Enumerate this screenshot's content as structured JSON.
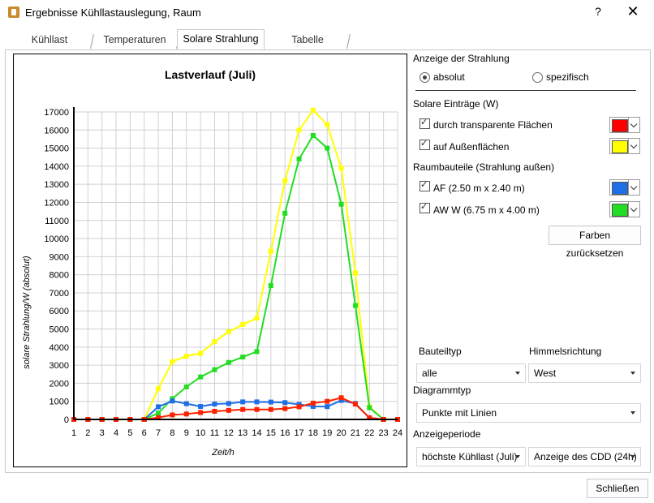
{
  "window": {
    "title": "Ergebnisse Kühllastauslegung, Raum",
    "help": "?",
    "close": "✕"
  },
  "tabs": [
    {
      "label": "Kühllast"
    },
    {
      "label": "Temperaturen"
    },
    {
      "label": "Solare Strahlung",
      "active": true
    },
    {
      "label": "Tabelle"
    }
  ],
  "chart_data": {
    "type": "line",
    "title": "Lastverlauf (Juli)",
    "xlabel": "Zeit/h",
    "ylabel": "solare Strahlung/W (absolut)",
    "x": [
      1,
      2,
      3,
      4,
      5,
      6,
      7,
      8,
      9,
      10,
      11,
      12,
      13,
      14,
      15,
      16,
      17,
      18,
      19,
      20,
      21,
      22,
      23,
      24
    ],
    "xlim": [
      1,
      24
    ],
    "ylim": [
      0,
      17000
    ],
    "yticks": [
      0,
      1000,
      2000,
      3000,
      4000,
      5000,
      6000,
      7000,
      8000,
      9000,
      10000,
      11000,
      12000,
      13000,
      14000,
      15000,
      16000,
      17000
    ],
    "grid": true,
    "series": [
      {
        "color": "#ffff00",
        "values": [
          0,
          0,
          0,
          0,
          0,
          0,
          1700,
          3200,
          3500,
          3650,
          4300,
          4850,
          5250,
          5600,
          9300,
          13200,
          16000,
          17100,
          16300,
          13900,
          8100,
          700,
          0,
          0
        ]
      },
      {
        "color": "#22dd22",
        "values": [
          0,
          0,
          0,
          0,
          0,
          0,
          350,
          1150,
          1800,
          2350,
          2750,
          3150,
          3450,
          3750,
          7400,
          11400,
          14400,
          15700,
          15000,
          11900,
          6300,
          650,
          0,
          0
        ]
      },
      {
        "color": "#1e6ee6",
        "values": [
          0,
          0,
          0,
          0,
          0,
          0,
          700,
          1020,
          870,
          720,
          850,
          880,
          970,
          970,
          960,
          930,
          830,
          720,
          710,
          1050,
          880,
          90,
          0,
          0
        ]
      },
      {
        "color": "#ff2200",
        "values": [
          0,
          0,
          0,
          0,
          0,
          0,
          100,
          250,
          300,
          380,
          450,
          500,
          550,
          550,
          550,
          600,
          700,
          900,
          1000,
          1200,
          850,
          90,
          0,
          0
        ]
      }
    ]
  },
  "panel": {
    "anzeige_heading": "Anzeige der Strahlung",
    "radio_absolut": "absolut",
    "radio_spezifisch": "spezifisch",
    "solare_heading": "Solare Einträge (W)",
    "cb_transparent": "durch transparente Flächen",
    "cb_aussen": "auf Außenflächen",
    "color_transparent": "#ff0000",
    "color_aussen": "#ffff00",
    "raumbauteile_heading": "Raumbauteile (Strahlung außen)",
    "cb_af": "AF (2.50 m x 2.40 m)",
    "cb_aww": "AW W (6.75 m x 4.00 m)",
    "color_af": "#1e6ee6",
    "color_aww": "#22dd22",
    "reset_button": "Farben zurücksetzen",
    "bauteiltyp_label": "Bauteiltyp",
    "bauteiltyp_value": "alle",
    "himmelsrichtung_label": "Himmelsrichtung",
    "himmelsrichtung_value": "West",
    "diagrammtyp_label": "Diagrammtyp",
    "diagrammtyp_value": "Punkte mit Linien",
    "anzeigeperiode_label": "Anzeigeperiode",
    "periode_value": "höchste Kühllast (Juli)",
    "cdd_value": "Anzeige des CDD (24h)"
  },
  "footer": {
    "close_button": "Schließen"
  }
}
